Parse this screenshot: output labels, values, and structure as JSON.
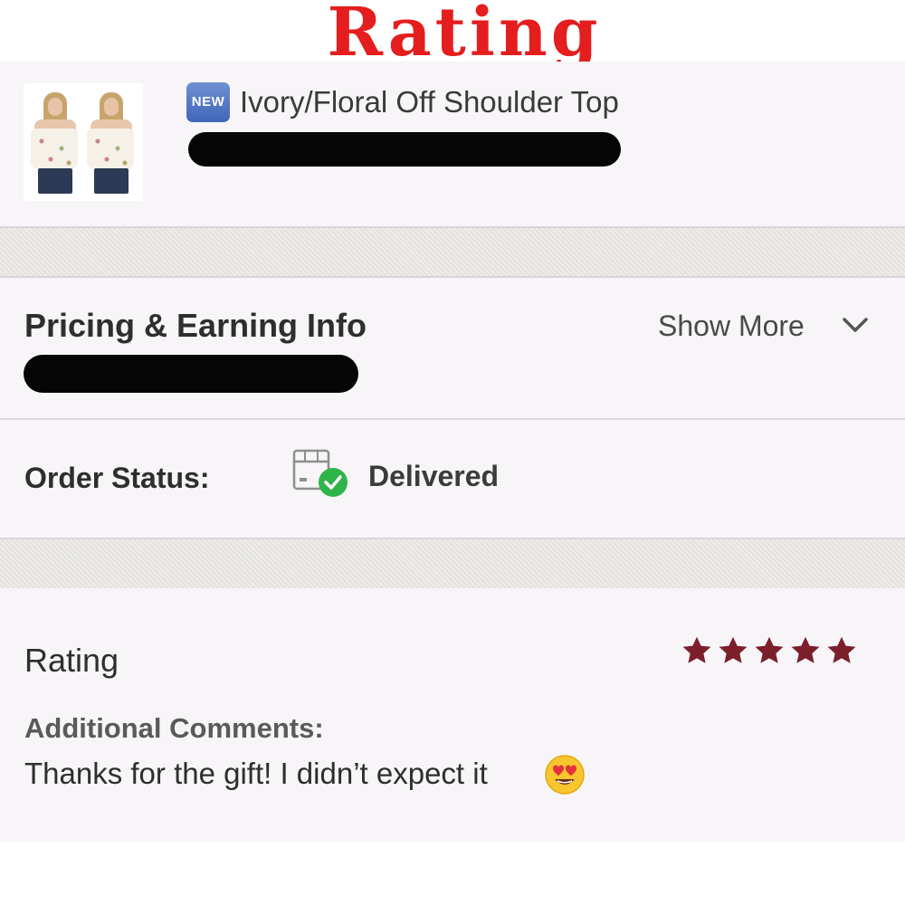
{
  "banner": {
    "title": "Rating",
    "color": "#e41e1e"
  },
  "product": {
    "badge": "NEW",
    "title": "Ivory/Floral Off Shoulder Top",
    "thumbnail": "product-photo"
  },
  "pricing": {
    "title": "Pricing & Earning Info",
    "show_more": "Show More",
    "toggle_icon": "chevron-down-icon"
  },
  "order": {
    "label": "Order Status:",
    "value": "Delivered",
    "icon": "package-delivered-icon"
  },
  "rating": {
    "title": "Rating",
    "stars": 5,
    "max_stars": 5,
    "star_color": "#7b1f2b",
    "comments_label": "Additional Comments:",
    "comment": "Thanks for the gift! I didn’t expect it",
    "emoji": "heart-eyes-emoji"
  },
  "colors": {
    "panel": "#f7f5f7",
    "separator": "#e9e7e3",
    "success": "#2fb44a"
  }
}
